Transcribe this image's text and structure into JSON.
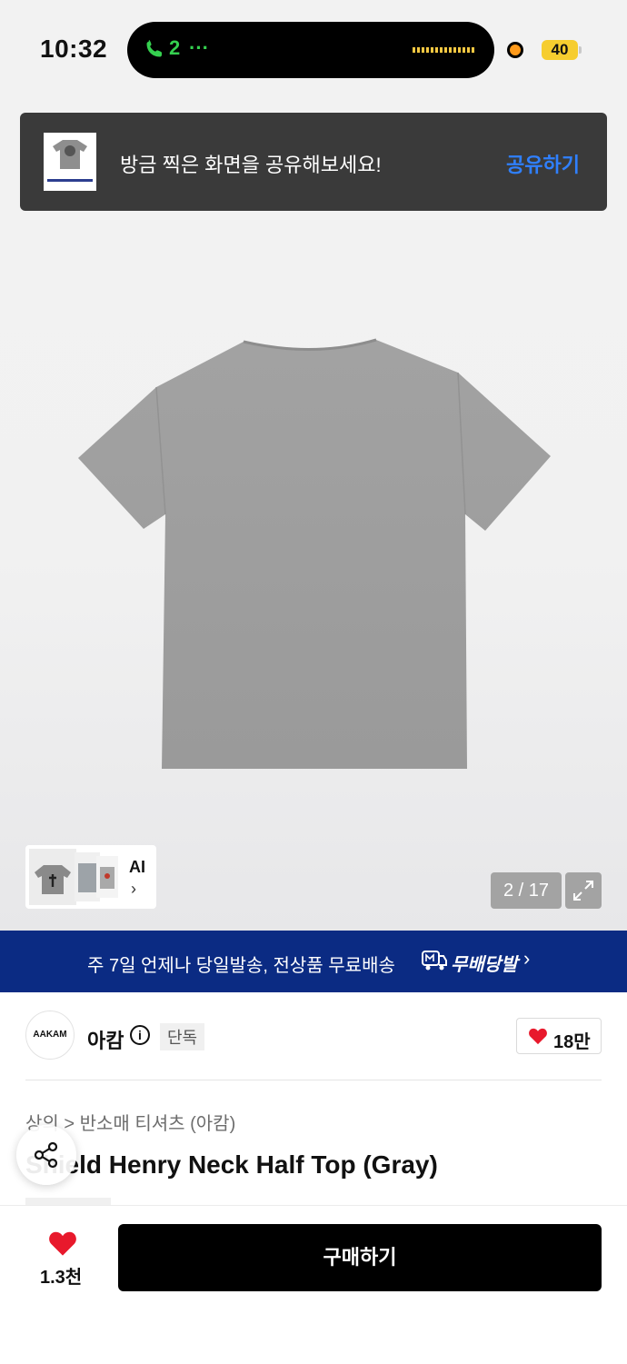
{
  "status_bar": {
    "time": "10:32",
    "call_count": "2",
    "call_dots": "···",
    "battery": "40"
  },
  "toast": {
    "message": "방금 찍은 화면을 공유해보세요!",
    "action": "공유하기"
  },
  "gallery": {
    "ai_label": "AI",
    "ai_chevron": "›",
    "pager": "2 / 17"
  },
  "banner": {
    "text": "주 7일 언제나 당일발송, 전상품 무료배송",
    "brand": "무배당발",
    "chevron": "›"
  },
  "brand": {
    "logo_text": "AAKAM",
    "name": "아캄",
    "info_glyph": "i",
    "badge": "단독",
    "likes": "18만"
  },
  "product": {
    "breadcrumb": "상의 > 반소매 티셔츠 (아캄)",
    "title": "Shield Henry Neck Half Top (Gray)"
  },
  "bottom_bar": {
    "wish_count": "1.3천",
    "buy_label": "구매하기"
  },
  "colors": {
    "accent_blue": "#2f80ff",
    "banner_navy": "#0b2b83",
    "heart_red": "#e8192c",
    "buy_black": "#000000"
  }
}
